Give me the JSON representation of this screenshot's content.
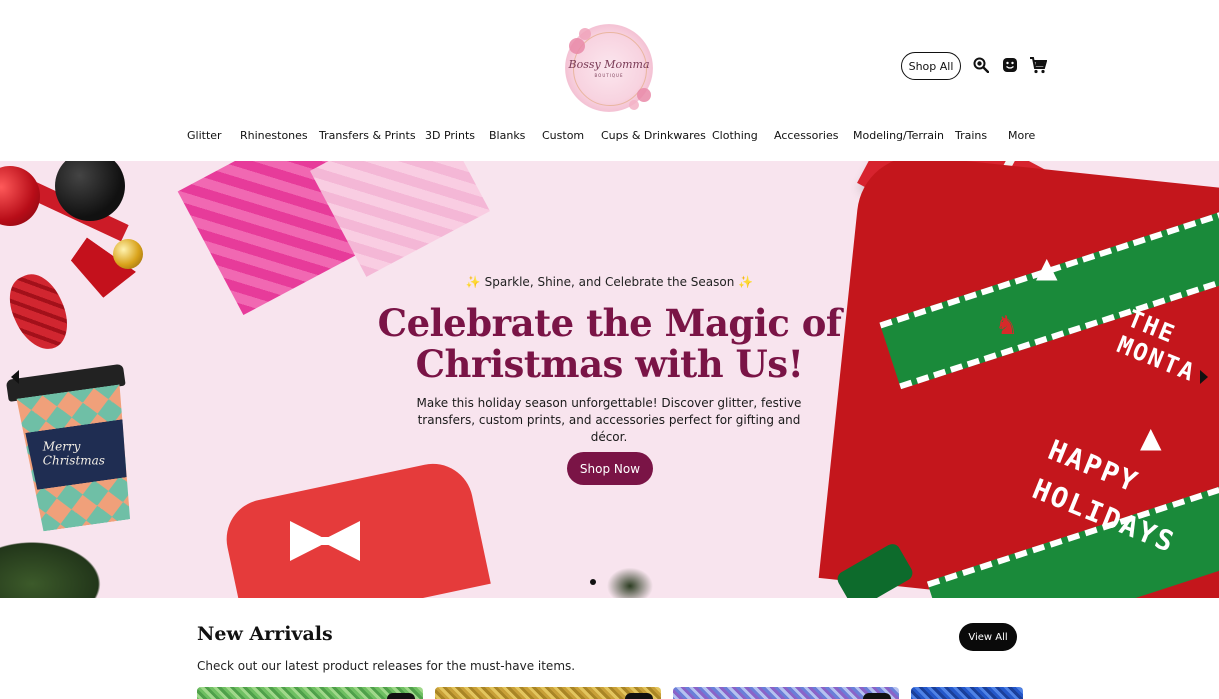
{
  "brand": {
    "logo_text": "Bossy Momma",
    "logo_sub": "BOUTIQUE"
  },
  "header": {
    "shop_all": "Shop All",
    "icons": [
      "search-icon",
      "account-icon",
      "cart-icon"
    ]
  },
  "nav": {
    "items": [
      {
        "label": "Glitter"
      },
      {
        "label": "Rhinestones"
      },
      {
        "label": "Transfers & Prints"
      },
      {
        "label": "3D Prints"
      },
      {
        "label": "Blanks"
      },
      {
        "label": "Custom"
      },
      {
        "label": "Cups & Drinkwares"
      },
      {
        "label": "Clothing"
      },
      {
        "label": "Accessories"
      },
      {
        "label": "Modeling/Terrain"
      },
      {
        "label": "Trains"
      },
      {
        "label": "More"
      }
    ]
  },
  "hero": {
    "tagline": "✨ Sparkle, Shine, and Celebrate the Season ✨",
    "headline_line1": "Celebrate the Magic of",
    "headline_line2": "Christmas with Us!",
    "description": "Make this holiday season unforgettable! Discover glitter, festive transfers, custom prints, and accessories perfect for gifting and décor.",
    "cta": "Shop Now",
    "cup_text": "Merry Christmas",
    "sweater_text_top": "THE MONTA",
    "sweater_text_main": "HAPPY HOLIDAYS",
    "accent_color": "#7a1446"
  },
  "arrivals": {
    "title": "New Arrivals",
    "subtitle": "Check out our latest product releases for the must-have items.",
    "view_all": "View All"
  }
}
